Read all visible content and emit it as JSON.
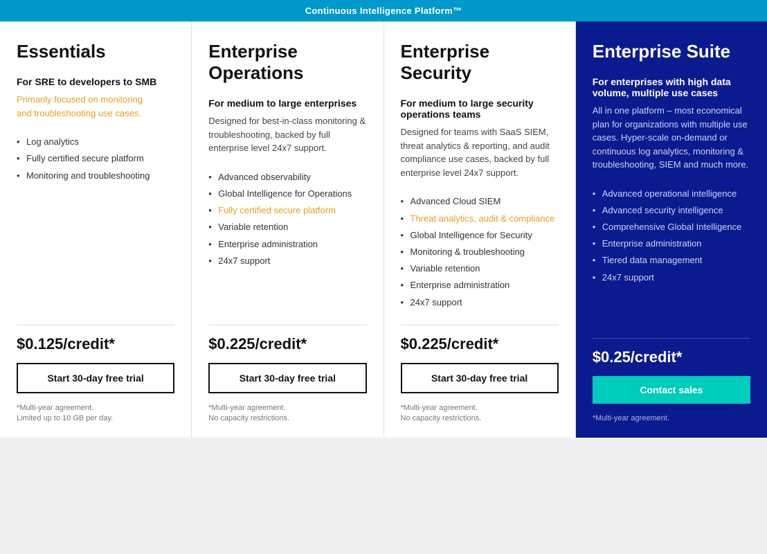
{
  "topBar": {
    "label": "Continuous Intelligence Platform™"
  },
  "plans": [
    {
      "id": "essentials",
      "title": "Essentials",
      "subtitle": "For SRE to developers to SMB",
      "desc_plain": "Primarily focused on monitoring and troubleshooting use cases.",
      "desc_highlighted": [
        "Primarily focused on monitoring and troubleshooting use cases."
      ],
      "desc_highlight_text": "Primarily focused on monitoring\nand troubleshooting use cases.",
      "features": [
        {
          "text": "Log analytics",
          "highlight": false
        },
        {
          "text": "Fully certified secure platform",
          "highlight": false
        },
        {
          "text": "Monitoring and troubleshooting",
          "highlight": false
        }
      ],
      "price": "$0.125/credit*",
      "cta_label": "Start 30-day free trial",
      "cta_type": "trial",
      "footnote": "*Multi-year agreement.\nLimited up to 10 GB per day."
    },
    {
      "id": "enterprise-operations",
      "title": "Enterprise Operations",
      "subtitle": "For medium to large enterprises",
      "desc_plain": "Designed for best-in-class monitoring & troubleshooting, backed by full enterprise level 24x7 support.",
      "features": [
        {
          "text": "Advanced observability",
          "highlight": false
        },
        {
          "text": "Global Intelligence for Operations",
          "highlight": false
        },
        {
          "text": "Fully certified secure platform",
          "highlight": true
        },
        {
          "text": "Variable retention",
          "highlight": false
        },
        {
          "text": "Enterprise administration",
          "highlight": false
        },
        {
          "text": "24x7 support",
          "highlight": false
        }
      ],
      "price": "$0.225/credit*",
      "cta_label": "Start 30-day free trial",
      "cta_type": "trial",
      "footnote": "*Multi-year agreement.\nNo capacity restrictions."
    },
    {
      "id": "enterprise-security",
      "title": "Enterprise Security",
      "subtitle": "For medium to large security operations teams",
      "desc_plain": "Designed for teams with SaaS SIEM, threat analytics & reporting, and audit compliance use cases, backed by full enterprise level 24x7 support.",
      "features": [
        {
          "text": "Advanced Cloud SIEM",
          "highlight": false
        },
        {
          "text": "Threat analytics, audit & compliance",
          "highlight": true
        },
        {
          "text": "Global Intelligence for Security",
          "highlight": false
        },
        {
          "text": "Monitoring & troubleshooting",
          "highlight": false
        },
        {
          "text": "Variable retention",
          "highlight": false
        },
        {
          "text": "Enterprise administration",
          "highlight": false
        },
        {
          "text": "24x7 support",
          "highlight": false
        }
      ],
      "price": "$0.225/credit*",
      "cta_label": "Start 30-day free trial",
      "cta_type": "trial",
      "footnote": "*Multi-year agreement.\nNo capacity restrictions."
    },
    {
      "id": "enterprise-suite",
      "title": "Enterprise Suite",
      "subtitle": "For enterprises with high data volume, multiple use cases",
      "desc_plain": "All in one platform – most economical plan for organizations with multiple use cases. Hyper-scale on-demand or continuous log analytics, monitoring & troubleshooting, SIEM and much more.",
      "features": [
        {
          "text": "Advanced operational intelligence",
          "highlight": false
        },
        {
          "text": "Advanced security intelligence",
          "highlight": false
        },
        {
          "text": "Comprehensive Global Intelligence",
          "highlight": false
        },
        {
          "text": "Enterprise administration",
          "highlight": false
        },
        {
          "text": "Tiered data management",
          "highlight": false
        },
        {
          "text": "24x7 support",
          "highlight": false
        }
      ],
      "price": "$0.25/credit*",
      "cta_label": "Contact sales",
      "cta_type": "contact",
      "footnote": "*Multi-year agreement."
    }
  ]
}
